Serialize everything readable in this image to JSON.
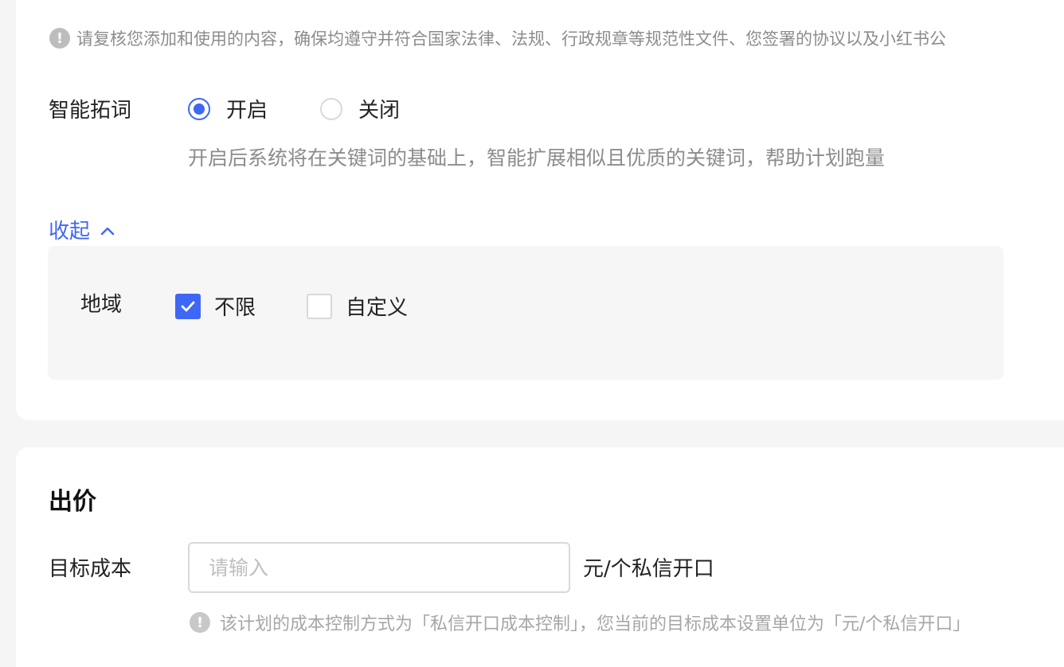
{
  "colors": {
    "accent": "#3f67f5",
    "muted_text": "#8c8c8c",
    "border": "#d9d9d9"
  },
  "notice": {
    "icon": "exclamation-circle-icon",
    "text": "请复核您添加和使用的内容，确保均遵守并符合国家法律、法规、行政规章等规范性文件、您签署的协议以及小红书公"
  },
  "smart_expand": {
    "label": "智能拓词",
    "options": [
      {
        "label": "开启",
        "selected": true
      },
      {
        "label": "关闭",
        "selected": false
      }
    ],
    "help": "开启后系统将在关键词的基础上，智能扩展相似且优质的关键词，帮助计划跑量"
  },
  "collapse": {
    "label": "收起",
    "icon": "chevron-up-icon"
  },
  "region": {
    "label": "地域",
    "options": [
      {
        "label": "不限",
        "checked": true
      },
      {
        "label": "自定义",
        "checked": false
      }
    ]
  },
  "bidding": {
    "title": "出价",
    "target_cost": {
      "label": "目标成本",
      "placeholder": "请输入",
      "value": "",
      "unit": "元/个私信开口"
    },
    "hint_icon": "exclamation-circle-icon",
    "hint": "该计划的成本控制方式为「私信开口成本控制」，您当前的目标成本设置单位为「元/个私信开口」"
  }
}
